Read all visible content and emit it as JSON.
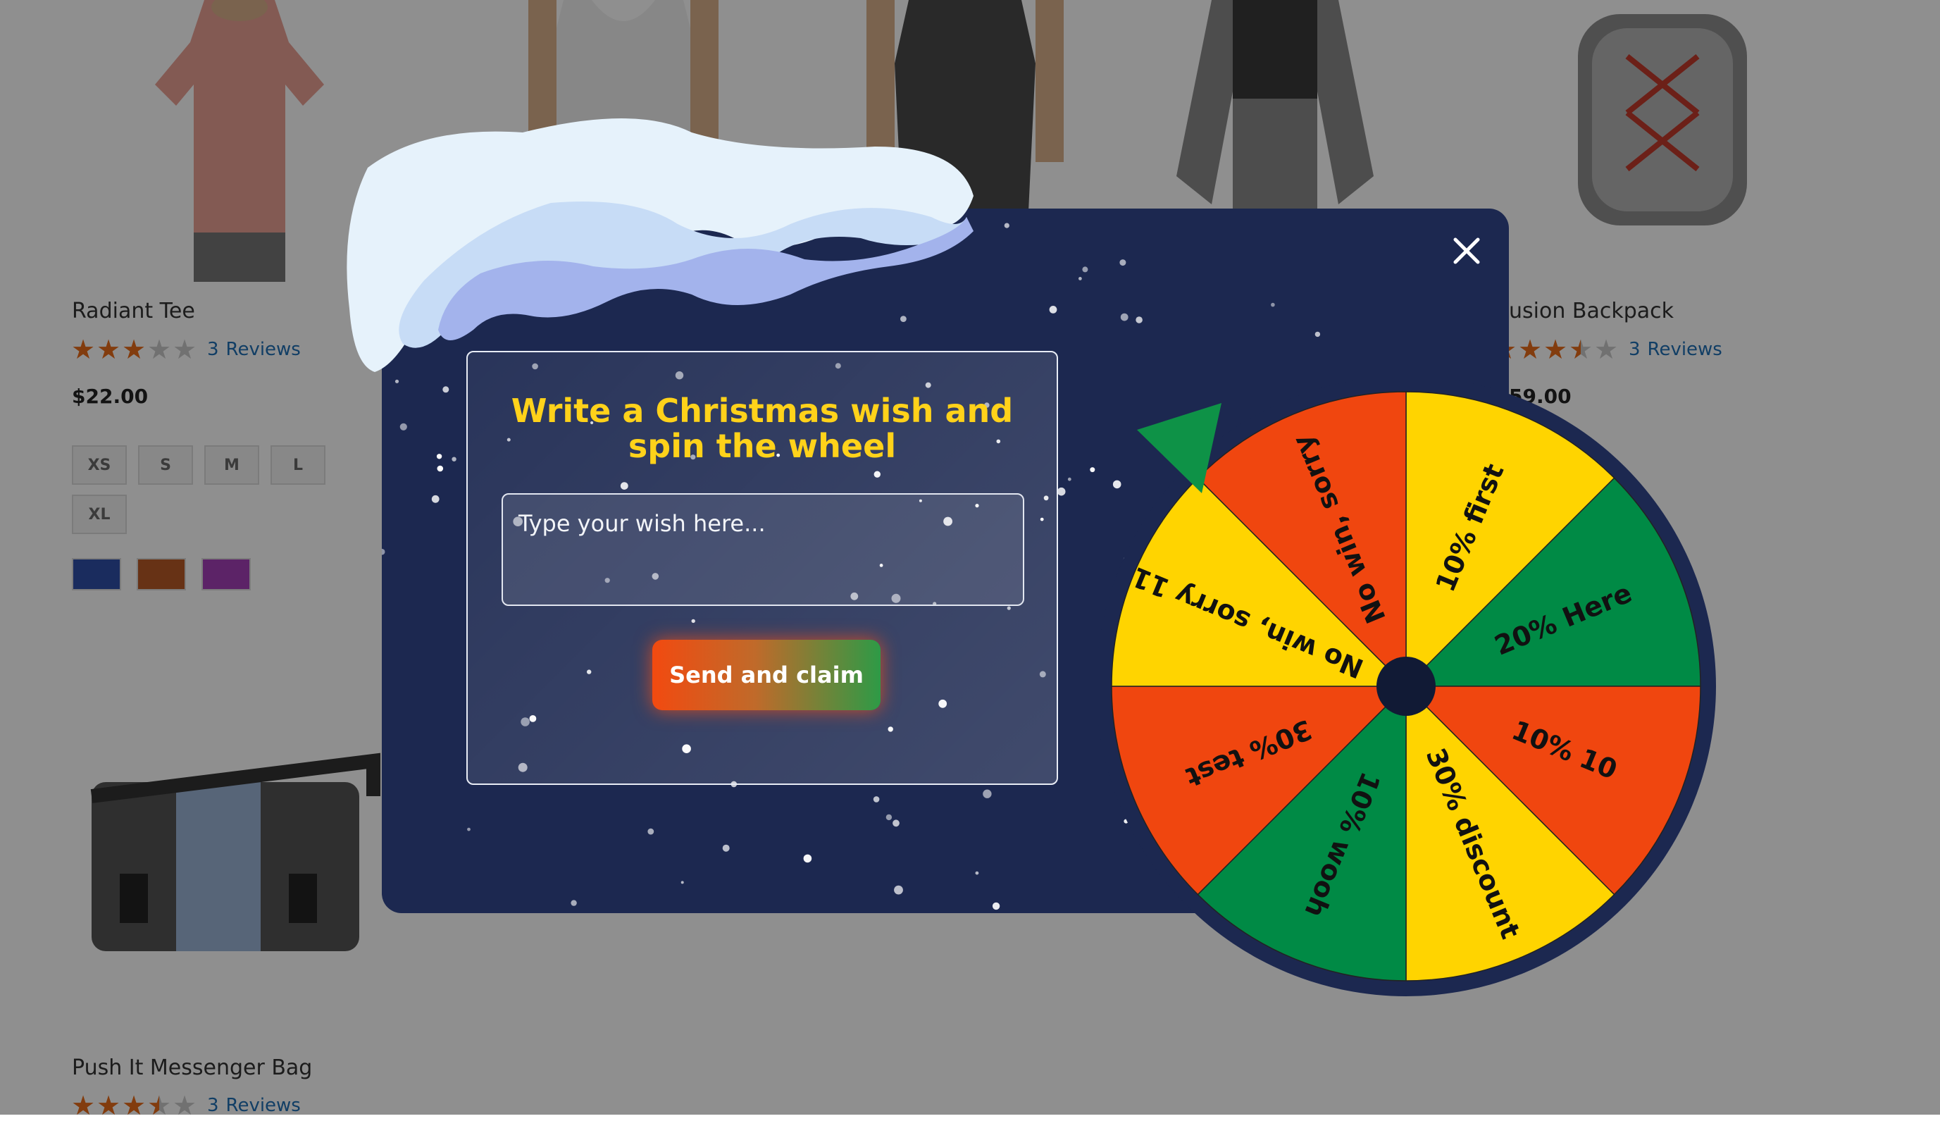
{
  "storefront": {
    "products": [
      {
        "name": "Radiant Tee",
        "reviews_count": "3",
        "reviews_label": "Reviews",
        "rating": 3,
        "price": "$22.00",
        "sizes": [
          "XS",
          "S",
          "M",
          "L",
          "XL"
        ],
        "colors": [
          "#2f4fa8",
          "#b85a26",
          "#a43fb8"
        ]
      },
      {
        "name": "usion Backpack",
        "reviews_count": "3",
        "reviews_label": "Reviews",
        "rating": 3.5,
        "price": "59.00"
      },
      {
        "name": "Push It Messenger Bag",
        "reviews_count": "3",
        "reviews_label": "Reviews",
        "rating": 3.5
      }
    ]
  },
  "popup": {
    "title": "Write a Christmas wish and spin the wheel",
    "wish_placeholder": "Type your wish here...",
    "submit_label": "Send and claim",
    "close_icon": "close-icon",
    "colors": {
      "title": "#ffd21a",
      "panel": "#1c2850",
      "wheel_rim": "#1c2850"
    }
  },
  "wheel": {
    "segments": [
      {
        "label": "10% first",
        "color": "#ffd400"
      },
      {
        "label": "20% Here",
        "color": "#008a45"
      },
      {
        "label": "10% 10",
        "color": "#f0460f"
      },
      {
        "label": "30% discount",
        "color": "#ffd400"
      },
      {
        "label": "10% wooh",
        "color": "#008a45"
      },
      {
        "label": "30% test",
        "color": "#f0460f"
      },
      {
        "label": "No win, sorry 11",
        "color": "#ffd400"
      },
      {
        "label": "No win, sorry",
        "color": "#f0460f"
      }
    ],
    "pointer_color": "#0e9247",
    "hub_color": "#111a35"
  }
}
